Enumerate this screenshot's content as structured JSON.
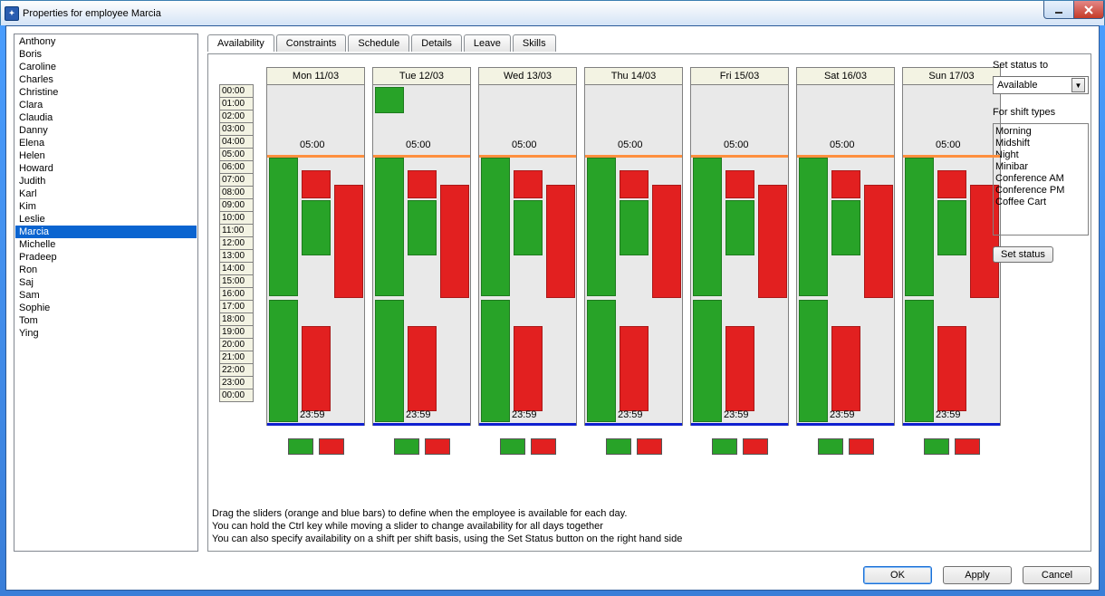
{
  "window": {
    "title": "Properties for employee Marcia",
    "minimize_aria": "_",
    "close_aria": "X"
  },
  "employees": [
    "Anthony",
    "Boris",
    "Caroline",
    "Charles",
    "Christine",
    "Clara",
    "Claudia",
    "Danny",
    "Elena",
    "Helen",
    "Howard",
    "Judith",
    "Karl",
    "Kim",
    "Leslie",
    "Marcia",
    "Michelle",
    "Pradeep",
    "Ron",
    "Saj",
    "Sam",
    "Sophie",
    "Tom",
    "Ying"
  ],
  "selected_employee": "Marcia",
  "tabs": [
    "Availability",
    "Constraints",
    "Schedule",
    "Details",
    "Leave",
    "Skills"
  ],
  "active_tab": "Availability",
  "hours": [
    "00:00",
    "01:00",
    "02:00",
    "03:00",
    "04:00",
    "05:00",
    "06:00",
    "07:00",
    "08:00",
    "09:00",
    "10:00",
    "11:00",
    "12:00",
    "13:00",
    "14:00",
    "15:00",
    "16:00",
    "17:00",
    "18:00",
    "19:00",
    "20:00",
    "21:00",
    "22:00",
    "23:00",
    "00:00"
  ],
  "days": [
    {
      "label": "Mon 11/03",
      "start": "05:00",
      "end": "23:59",
      "extra_green_top": false
    },
    {
      "label": "Tue 12/03",
      "start": "05:00",
      "end": "23:59",
      "extra_green_top": true
    },
    {
      "label": "Wed 13/03",
      "start": "05:00",
      "end": "23:59",
      "extra_green_top": false
    },
    {
      "label": "Thu 14/03",
      "start": "05:00",
      "end": "23:59",
      "extra_green_top": false
    },
    {
      "label": "Fri 15/03",
      "start": "05:00",
      "end": "23:59",
      "extra_green_top": false
    },
    {
      "label": "Sat 16/03",
      "start": "05:00",
      "end": "23:59",
      "extra_green_top": false
    },
    {
      "label": "Sun 17/03",
      "start": "05:00",
      "end": "23:59",
      "extra_green_top": false
    }
  ],
  "status": {
    "label": "Set status to",
    "value": "Available",
    "shift_label": "For shift types",
    "shifts": [
      "Morning",
      "Midshift",
      "Night",
      "Minibar",
      "Conference AM",
      "Conference PM",
      "Coffee Cart"
    ],
    "button": "Set status"
  },
  "help": {
    "line1": "Drag the sliders (orange and blue bars) to define when the employee is available for each day.",
    "line2": "You can hold the Ctrl key while moving a slider to change availability for all days together",
    "line3": "You can also specify availability on a shift per shift basis, using the Set Status button on the right hand side"
  },
  "buttons": {
    "ok": "OK",
    "apply": "Apply",
    "cancel": "Cancel"
  }
}
